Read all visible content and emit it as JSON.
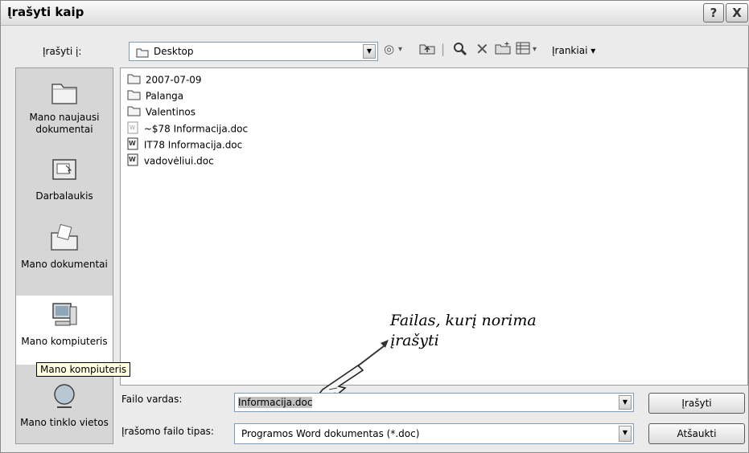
{
  "window": {
    "title": "Įrašyti kaip",
    "help_label": "?",
    "close_label": "X"
  },
  "toolbar": {
    "save_in_label": "Įrašyti į:",
    "location_value": "Desktop",
    "tools_menu_label": "Įrankiai ▾",
    "icons": [
      "back-icon",
      "up-folder-icon",
      "search-web-icon",
      "delete-icon",
      "new-folder-icon",
      "views-icon"
    ]
  },
  "places": [
    {
      "label": "Mano naujausi dokumentai",
      "icon": "recent-documents-icon"
    },
    {
      "label": "Darbalaukis",
      "icon": "desktop-icon"
    },
    {
      "label": "Mano dokumentai",
      "icon": "my-documents-icon"
    },
    {
      "label": "Mano kompiuteris",
      "icon": "my-computer-icon",
      "selected": true
    },
    {
      "label": "Mano tinklo vietos",
      "icon": "network-places-icon"
    }
  ],
  "files": [
    {
      "name": "2007-07-09",
      "type": "folder"
    },
    {
      "name": "Palanga",
      "type": "folder"
    },
    {
      "name": "Valentinos",
      "type": "folder"
    },
    {
      "name": "~$78 Informacija.doc",
      "type": "doc-temp"
    },
    {
      "name": "IT78 Informacija.doc",
      "type": "doc"
    },
    {
      "name": "vadovėliui.doc",
      "type": "doc"
    }
  ],
  "tooltip": "Mano kompiuteris",
  "annotation": {
    "line1": "Failas, kurį norima",
    "line2": "įrašyti"
  },
  "footer": {
    "filename_label": "Failo vardas:",
    "filename_value": "Informacija.doc",
    "filetype_label": "Įrašomo failo tipas:",
    "filetype_value": "Programos Word dokumentas (*.doc)",
    "save_label": "Įrašyti",
    "cancel_label": "Atšaukti"
  }
}
